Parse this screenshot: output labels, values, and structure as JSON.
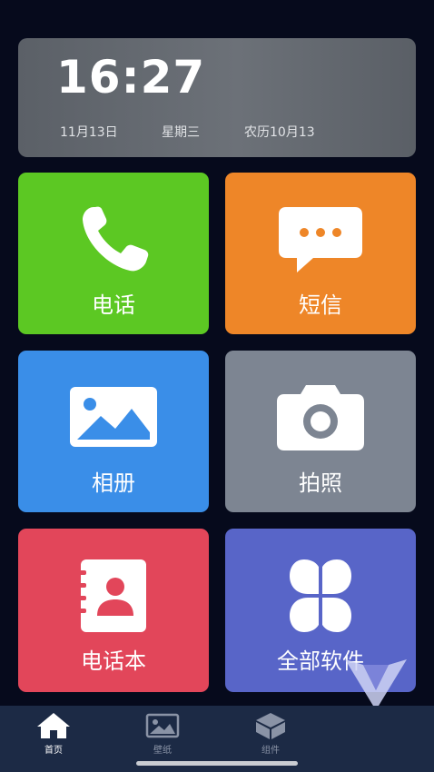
{
  "clock": {
    "time": "16:27",
    "date": "11月13日",
    "weekday": "星期三",
    "lunar": "农历10月13"
  },
  "tiles": [
    {
      "label": "电话",
      "icon": "phone-icon",
      "color": "#5cc823"
    },
    {
      "label": "短信",
      "icon": "message-icon",
      "color": "#ee8628"
    },
    {
      "label": "相册",
      "icon": "gallery-icon",
      "color": "#3a8ee8"
    },
    {
      "label": "拍照",
      "icon": "camera-icon",
      "color": "#7d8592"
    },
    {
      "label": "电话本",
      "icon": "contacts-book-icon",
      "color": "#e2465a"
    },
    {
      "label": "全部软件",
      "icon": "clover-apps-icon",
      "color": "#5865c8"
    }
  ],
  "bottom_nav": {
    "items": [
      {
        "label": "首页",
        "icon": "home-icon",
        "active": true
      },
      {
        "label": "壁纸",
        "icon": "wallpaper-icon",
        "active": false
      },
      {
        "label": "组件",
        "icon": "widget-cube-icon",
        "active": false
      }
    ]
  }
}
